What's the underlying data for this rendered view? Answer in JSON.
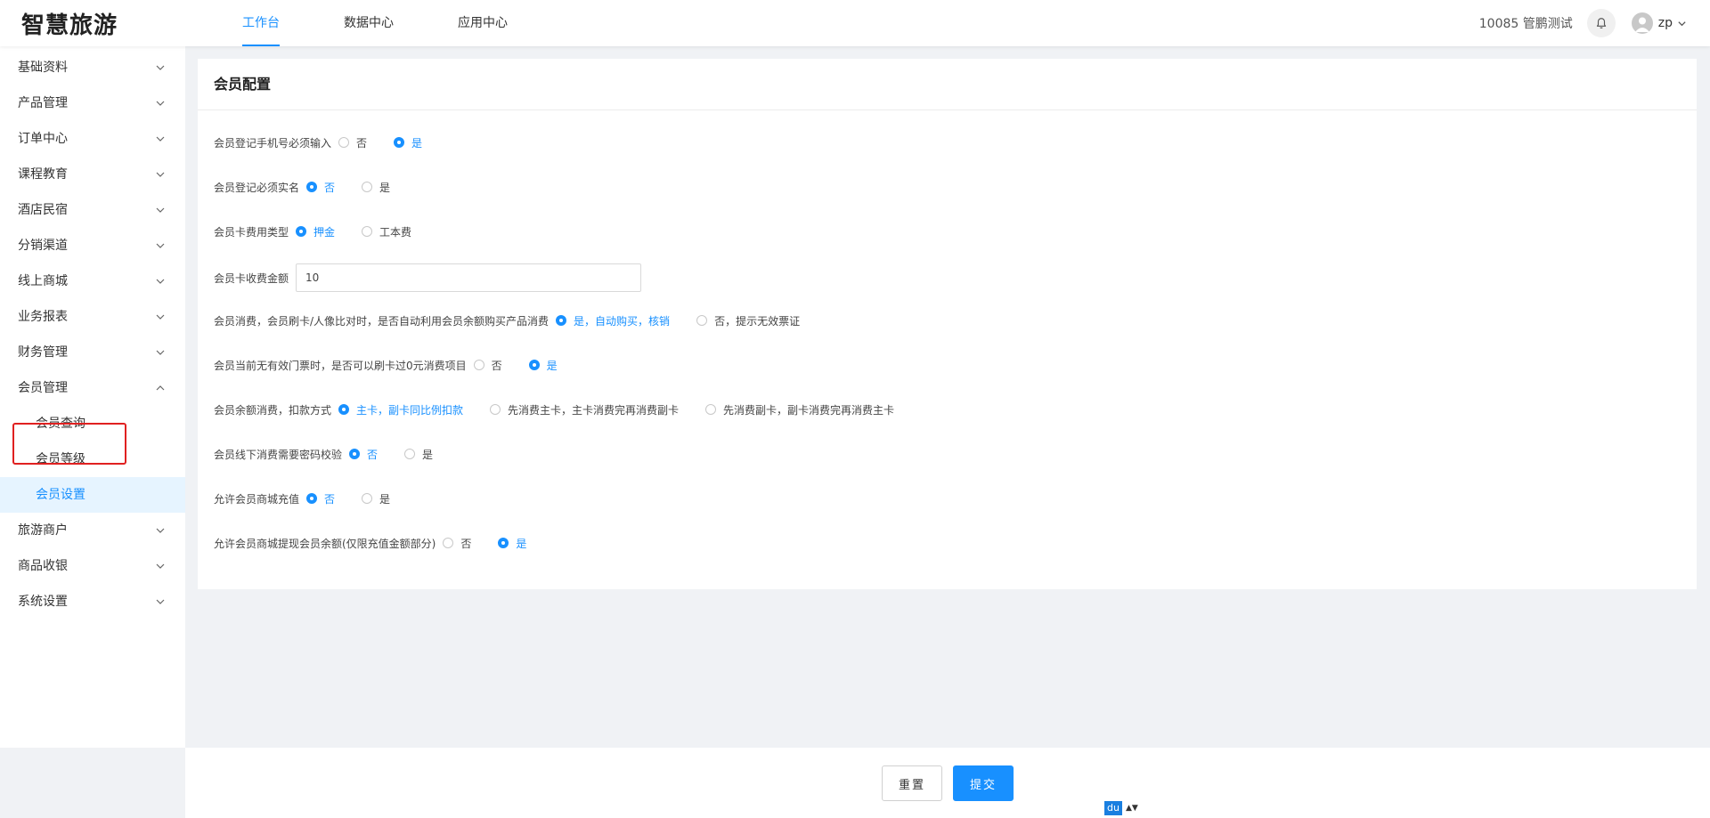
{
  "app": {
    "logo": "智慧旅游"
  },
  "topnav": {
    "items": [
      {
        "label": "工作台"
      },
      {
        "label": "数据中心"
      },
      {
        "label": "应用中心"
      }
    ]
  },
  "header": {
    "account": "10085 管鹏测试",
    "username": "zp"
  },
  "sidebar": {
    "items": [
      {
        "label": "基础资料"
      },
      {
        "label": "产品管理"
      },
      {
        "label": "订单中心"
      },
      {
        "label": "课程教育"
      },
      {
        "label": "酒店民宿"
      },
      {
        "label": "分销渠道"
      },
      {
        "label": "线上商城"
      },
      {
        "label": "业务报表"
      },
      {
        "label": "财务管理"
      },
      {
        "label": "会员管理"
      },
      {
        "label": "旅游商户"
      },
      {
        "label": "商品收银"
      },
      {
        "label": "系统设置"
      }
    ],
    "member_sub": [
      {
        "label": "会员查询"
      },
      {
        "label": "会员等级"
      },
      {
        "label": "会员设置"
      }
    ]
  },
  "panel": {
    "title": "会员配置",
    "rows": [
      {
        "label": "会员登记手机号必须输入",
        "options": [
          "否",
          "是"
        ],
        "selected": 1
      },
      {
        "label": "会员登记必须实名",
        "options": [
          "否",
          "是"
        ],
        "selected": 0
      },
      {
        "label": "会员卡费用类型",
        "options": [
          "押金",
          "工本费"
        ],
        "selected": 0
      },
      {
        "label": "会员卡收费金额",
        "value": "10"
      },
      {
        "label": "会员消费，会员刷卡/人像比对时，是否自动利用会员余额购买产品消费",
        "options": [
          "是，自动购买，核销",
          "否，提示无效票证"
        ],
        "selected": 0
      },
      {
        "label": "会员当前无有效门票时，是否可以刷卡过0元消费项目",
        "options": [
          "否",
          "是"
        ],
        "selected": 1
      },
      {
        "label": "会员余额消费，扣款方式",
        "options": [
          "主卡，副卡同比例扣款",
          "先消费主卡，主卡消费完再消费副卡",
          "先消费副卡，副卡消费完再消费主卡"
        ],
        "selected": 0
      },
      {
        "label": "会员线下消费需要密码校验",
        "options": [
          "否",
          "是"
        ],
        "selected": 0
      },
      {
        "label": "允许会员商城充值",
        "options": [
          "否",
          "是"
        ],
        "selected": 0
      },
      {
        "label": "允许会员商城提现会员余额(仅限充值金额部分)",
        "options": [
          "否",
          "是"
        ],
        "selected": 1
      }
    ]
  },
  "footer": {
    "reset_label": "重置",
    "submit_label": "提交"
  },
  "ime": {
    "badge": "du",
    "arrows": "▲▼"
  },
  "colors": {
    "accent": "#1890ff",
    "highlight_box": "#e02020"
  }
}
